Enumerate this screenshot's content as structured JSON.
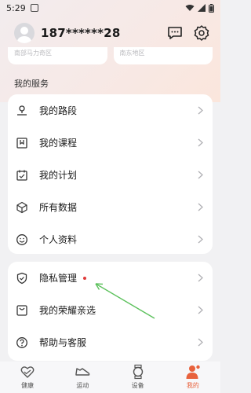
{
  "status_bar": {
    "time": "5:29"
  },
  "profile": {
    "username": "187******28"
  },
  "cut_cards": [
    "南部马力奇区",
    "南东地区"
  ],
  "section_title": "我的服务",
  "services": [
    {
      "label": "我的路段",
      "icon": "route-icon"
    },
    {
      "label": "我的课程",
      "icon": "course-icon"
    },
    {
      "label": "我的计划",
      "icon": "calendar-icon"
    },
    {
      "label": "所有数据",
      "icon": "cube-icon"
    },
    {
      "label": "个人资料",
      "icon": "smile-icon"
    }
  ],
  "other": [
    {
      "label": "隐私管理",
      "icon": "shield-icon",
      "badge": true
    },
    {
      "label": "我的荣耀亲选",
      "icon": "bag-icon",
      "badge": false
    },
    {
      "label": "帮助与客服",
      "icon": "help-icon",
      "badge": false
    }
  ],
  "tabs": [
    {
      "label": "健康",
      "icon": "heart-icon",
      "active": false
    },
    {
      "label": "运动",
      "icon": "shoe-icon",
      "active": false
    },
    {
      "label": "设备",
      "icon": "watch-icon",
      "active": false
    },
    {
      "label": "我的",
      "icon": "person-icon",
      "active": true
    }
  ],
  "colors": {
    "accent": "#e8623d",
    "badge": "#e03a3a",
    "arrow": "#5cc15c"
  }
}
